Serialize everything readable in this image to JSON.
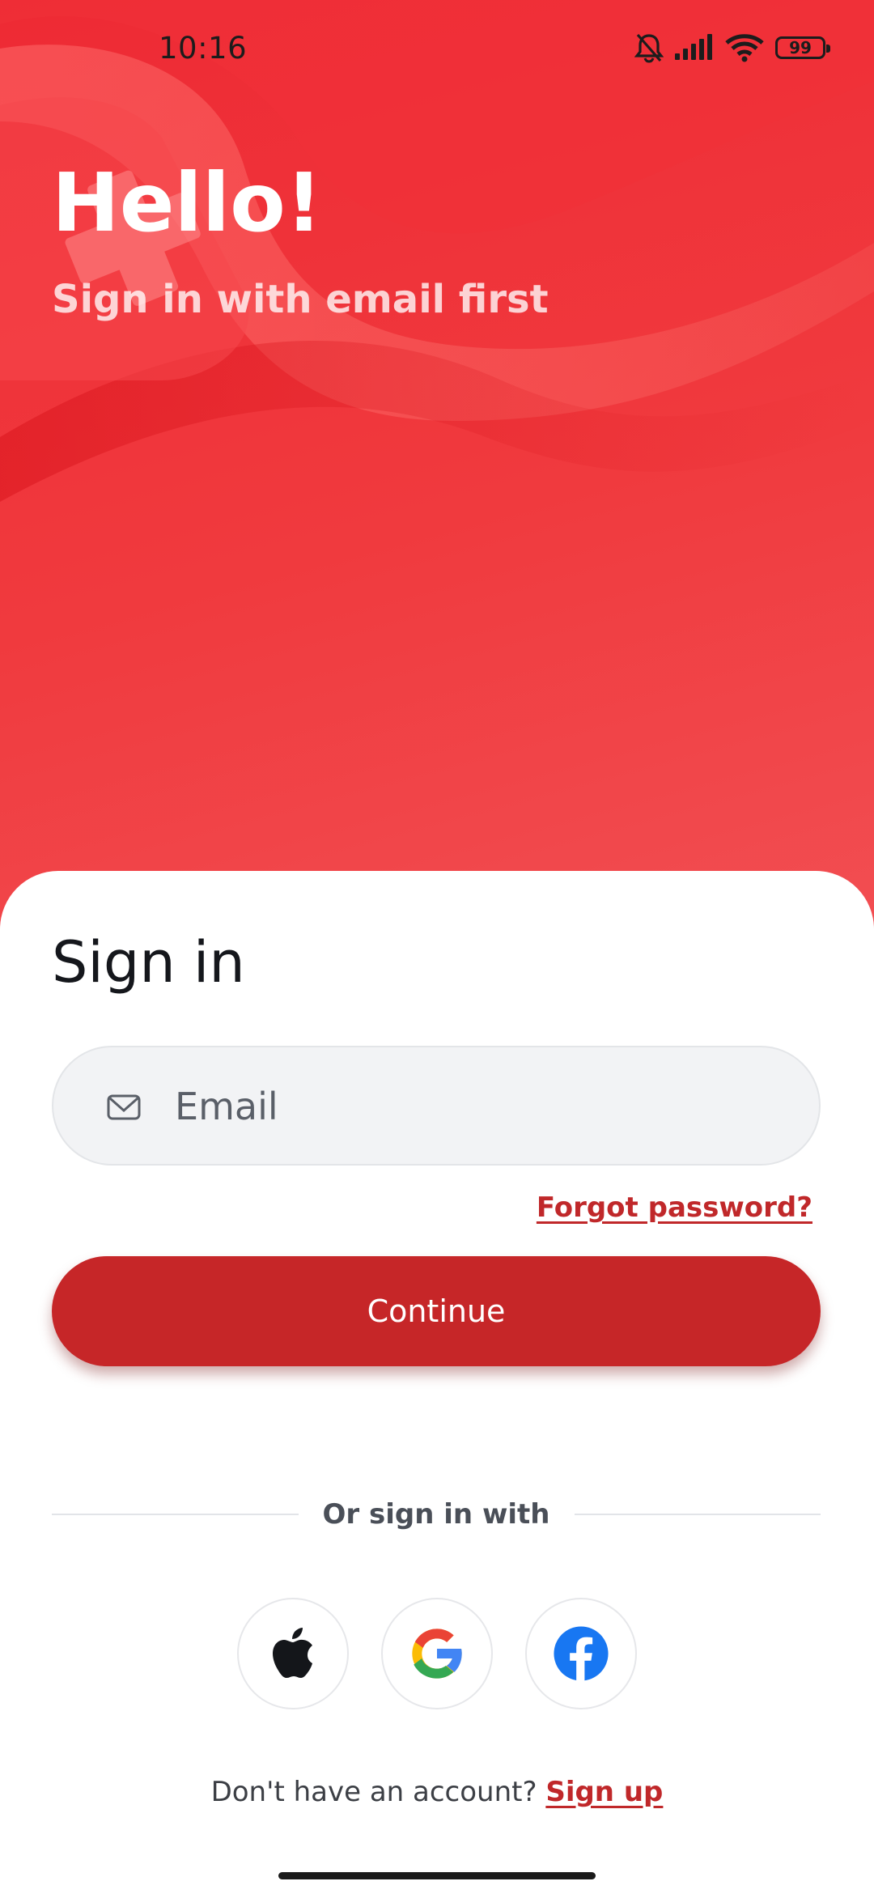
{
  "status_bar": {
    "time": "10:16",
    "battery_level": "99"
  },
  "hero": {
    "title": "Hello!",
    "subtitle": "Sign in with email first"
  },
  "sign_in": {
    "title": "Sign in",
    "email_placeholder": "Email",
    "email_value": "",
    "forgot_password_label": "Forgot password?",
    "continue_label": "Continue",
    "divider_label": "Or sign in with",
    "social_providers": [
      "apple-icon",
      "google-icon",
      "facebook-icon"
    ],
    "signup_prompt": "Don't have an account?",
    "signup_label": "Sign up"
  },
  "colors": {
    "brand_red": "#c62628",
    "link_red": "#c0282a",
    "hero_red": "#ee2a34",
    "facebook_blue": "#1877f2"
  }
}
